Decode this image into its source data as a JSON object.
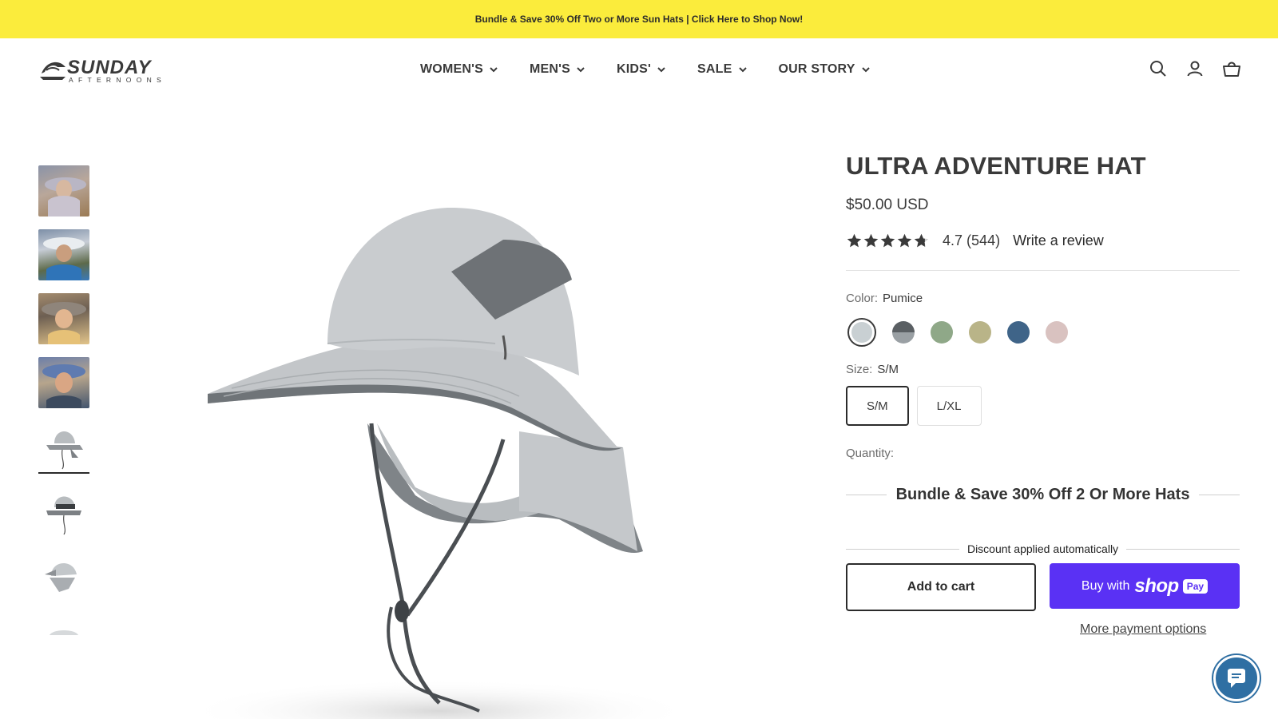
{
  "announcement": {
    "text": "Bundle & Save 30% Off Two or More Sun Hats | Click Here to Shop Now!"
  },
  "header": {
    "brand": "SUNDAY AFTERNOONS",
    "nav": [
      {
        "label": "WOMEN'S"
      },
      {
        "label": "MEN'S"
      },
      {
        "label": "KIDS'"
      },
      {
        "label": "SALE"
      },
      {
        "label": "OUR STORY"
      }
    ],
    "icons": [
      "search-icon",
      "account-icon",
      "cart-icon"
    ]
  },
  "gallery": {
    "thumbnail_count": 8,
    "active_index": 4
  },
  "product": {
    "title": "ULTRA ADVENTURE HAT",
    "price": "$50.00 USD",
    "rating": {
      "stars": 4.7,
      "score": "4.7",
      "count": "(544)",
      "write_review": "Write a review"
    },
    "color": {
      "label": "Color:",
      "selected": "Pumice",
      "swatches": [
        {
          "name": "Pumice",
          "hex": "#c9d0d3",
          "selected": true
        },
        {
          "name": "Charcoal",
          "hex": "#5a5f63",
          "accent": "#9aa0a4"
        },
        {
          "name": "Sage",
          "hex": "#8fa888"
        },
        {
          "name": "Khaki",
          "hex": "#b9b488"
        },
        {
          "name": "Blue",
          "hex": "#3f6488"
        },
        {
          "name": "Rose",
          "hex": "#d9c2c0"
        }
      ]
    },
    "size": {
      "label": "Size:",
      "selected": "S/M",
      "options": [
        {
          "label": "S/M",
          "selected": true
        },
        {
          "label": "L/XL",
          "selected": false
        }
      ]
    },
    "quantity_label": "Quantity:",
    "bundle_text": "Bundle & Save 30% Off 2 Or More Hats",
    "discount_text": "Discount applied automatically",
    "add_to_cart": "Add to cart",
    "buy_with": "Buy with",
    "shop_brand": "shop",
    "pay_badge": "Pay",
    "more_payment": "More payment options"
  },
  "colors": {
    "announcement_bg": "#fbec3c",
    "shop_pay": "#5a31f4",
    "chat": "#2f6fa3"
  }
}
